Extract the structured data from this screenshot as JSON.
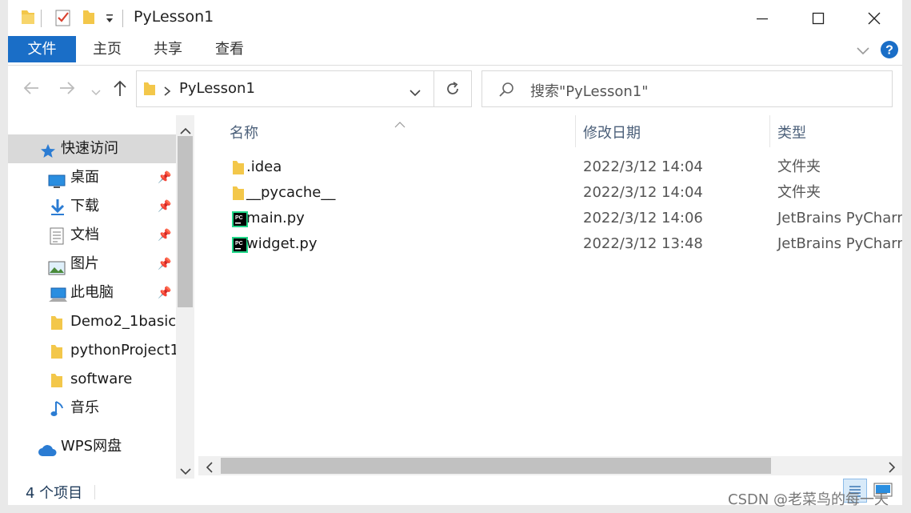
{
  "window": {
    "title": "PyLesson1"
  },
  "ribbon": {
    "tabs": [
      {
        "label": "文件",
        "active": true
      },
      {
        "label": "主页",
        "active": false
      },
      {
        "label": "共享",
        "active": false
      },
      {
        "label": "查看",
        "active": false
      }
    ]
  },
  "address": {
    "path": "PyLesson1",
    "search_placeholder": "搜索\"PyLesson1\""
  },
  "nav": {
    "items": [
      {
        "label": "快速访问",
        "icon": "star-icon",
        "pinned": false,
        "selected": true
      },
      {
        "label": "桌面",
        "icon": "desktop-icon",
        "pinned": true
      },
      {
        "label": "下载",
        "icon": "download-icon",
        "pinned": true
      },
      {
        "label": "文档",
        "icon": "document-icon",
        "pinned": true
      },
      {
        "label": "图片",
        "icon": "picture-icon",
        "pinned": true
      },
      {
        "label": "此电脑",
        "icon": "computer-icon",
        "pinned": true
      },
      {
        "label": "Demo2_1basic",
        "icon": "folder-icon",
        "pinned": false
      },
      {
        "label": "pythonProject1",
        "icon": "folder-icon",
        "pinned": false
      },
      {
        "label": "software",
        "icon": "folder-icon",
        "pinned": false
      },
      {
        "label": "音乐",
        "icon": "music-icon",
        "pinned": false
      },
      {
        "label": "WPS网盘",
        "icon": "cloud-icon",
        "pinned": false
      }
    ]
  },
  "files": {
    "columns": [
      "名称",
      "修改日期",
      "类型"
    ],
    "rows": [
      {
        "name": ".idea",
        "date": "2022/3/12 14:04",
        "type": "文件夹",
        "icon": "folder-icon"
      },
      {
        "name": "__pycache__",
        "date": "2022/3/12 14:04",
        "type": "文件夹",
        "icon": "folder-icon"
      },
      {
        "name": "main.py",
        "date": "2022/3/12 14:06",
        "type": "JetBrains PyCharm .",
        "icon": "pycharm-icon"
      },
      {
        "name": "widget.py",
        "date": "2022/3/12 13:48",
        "type": "JetBrains PyCharm .",
        "icon": "pycharm-icon"
      }
    ]
  },
  "status": {
    "item_count": "4 个项目"
  },
  "watermark": "CSDN @老菜鸟的每一天",
  "colors": {
    "accent": "#1a6ec7",
    "folder": "#f3c74a",
    "help": "#1a6ec7"
  }
}
